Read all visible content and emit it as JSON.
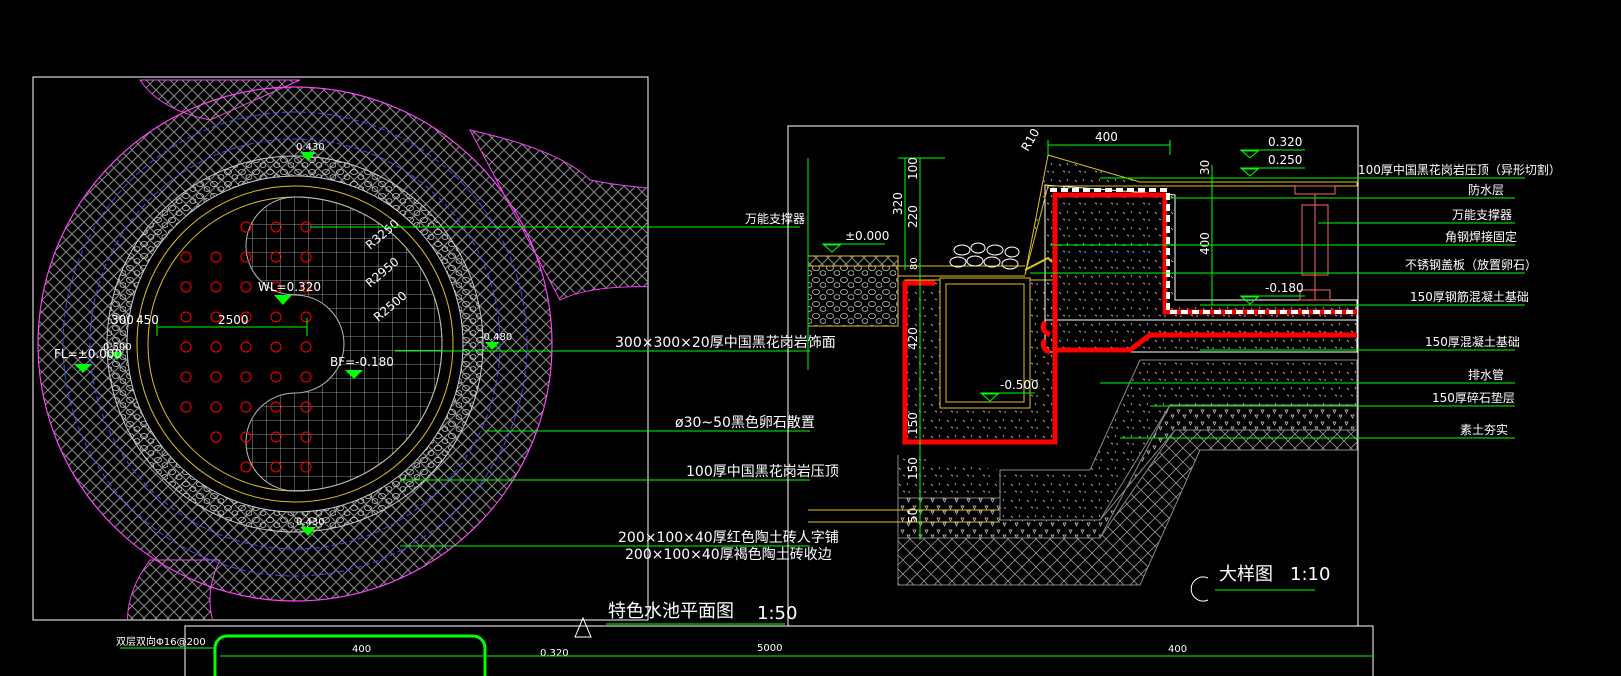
{
  "colors": {
    "background": "#000000",
    "frame": "#ffffff",
    "leader": "#00ff00",
    "rebar": "#ff0000",
    "hatch": "#8a8a8a",
    "outline_yellow": "#e0c020",
    "outline_blue": "#4a4aff",
    "outline_magenta": "#ff40ff"
  },
  "plan": {
    "title": "特色水池平面图",
    "scale": "1:50",
    "labels": {
      "top_elev": "0.430",
      "wl": "WL=0.320",
      "bf": "BF=-0.180",
      "fl": "FL=±0.000",
      "right_elev": "-0.480",
      "left_elev": "0.500",
      "bottom_elev": "0.430",
      "dim_2500": "2500",
      "dim_300": "300",
      "dim_450": "450",
      "r3250": "R3250",
      "r2950": "R2950",
      "r2500": "R2500"
    },
    "callouts": [
      "万能支撑器",
      "300×300×20厚中国黑花岗岩饰面",
      "ø30~50黑色卵石散置",
      "100厚中国黑花岗岩压顶",
      "200×100×40厚红色陶土砖人字铺",
      "200×100×40厚褐色陶土砖收边"
    ]
  },
  "detail": {
    "title": "大样图",
    "scale": "1:10",
    "marker": "C",
    "dims": {
      "d400": "400",
      "r10": "R10",
      "d320": "320",
      "d100": "100",
      "d220": "220",
      "d80": "80",
      "d420": "420",
      "d150a": "150",
      "d150b": "150",
      "d50": "50",
      "d30": "30",
      "d400v": "400"
    },
    "elevs": {
      "e0320": "0.320",
      "e0250": "0.250",
      "e000": "±0.000",
      "em0180": "-0.180",
      "em0500": "-0.500"
    },
    "callouts": [
      "100厚中国黑花岗岩压顶（异形切割）",
      "防水层",
      "万能支撑器",
      "角钢焊接固定",
      "不锈钢盖板（放置卵石）",
      "150厚钢筋混凝土基础",
      "150厚混凝土基础",
      "排水管",
      "150厚碎石垫层",
      "素土夯实"
    ]
  },
  "bottom": {
    "label": "双层双向Φ16@200",
    "d400a": "400",
    "d0320": "0.320",
    "d5000": "5000",
    "d400b": "400"
  }
}
